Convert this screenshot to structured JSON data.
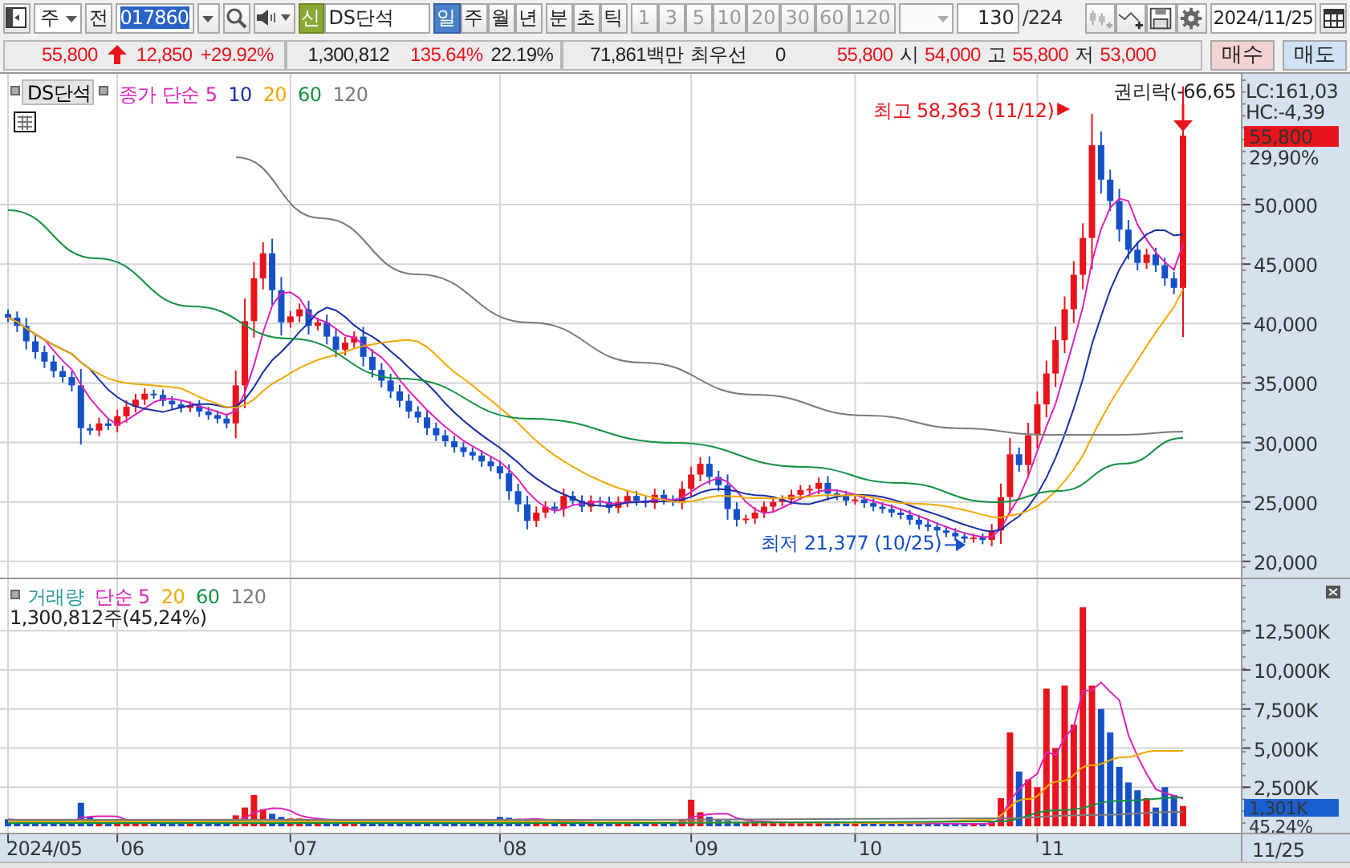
{
  "toolbar": {
    "market_select": {
      "value": "주"
    },
    "prev_button": "전",
    "code_field": {
      "value": "017860"
    },
    "name_badge": "신",
    "name_field": {
      "value": "DS단석"
    },
    "periods": [
      {
        "label": "일",
        "selected": true
      },
      {
        "label": "주",
        "selected": false
      },
      {
        "label": "월",
        "selected": false
      },
      {
        "label": "년",
        "selected": false
      },
      {
        "label": "분",
        "selected": false
      },
      {
        "label": "초",
        "selected": false
      },
      {
        "label": "틱",
        "selected": false
      }
    ],
    "intervals": [
      {
        "label": "1",
        "disabled": true
      },
      {
        "label": "3",
        "disabled": true
      },
      {
        "label": "5",
        "disabled": true
      },
      {
        "label": "10",
        "disabled": true
      },
      {
        "label": "20",
        "disabled": true
      },
      {
        "label": "30",
        "disabled": true
      },
      {
        "label": "60",
        "disabled": true
      },
      {
        "label": "120",
        "disabled": true
      }
    ],
    "count_field": {
      "value": "130"
    },
    "count_total": "/224",
    "date_field": {
      "value": "2024/11/25"
    }
  },
  "quote": {
    "price": "55,800",
    "change": "12,850",
    "change_rate": "+29.92%",
    "volume": "1,300,812",
    "volume_ratio": "135.64%",
    "turnover": "22.19%",
    "amount": "71,861백만",
    "best_label": "최우선",
    "best_qty": "0",
    "best_price": "55,800",
    "fields": [
      {
        "label": "시",
        "value": "54,000"
      },
      {
        "label": "고",
        "value": "55,800"
      },
      {
        "label": "저",
        "value": "53,000"
      }
    ],
    "buttons": [
      {
        "label": "매수",
        "kind": "buy"
      },
      {
        "label": "매도",
        "kind": "sell"
      }
    ]
  },
  "price_pane": {
    "name_tag": "DS단석",
    "legend": [
      {
        "label": "종가 단순 5",
        "color": "#dd22bb"
      },
      {
        "label": "10",
        "color": "#1a2fa8"
      },
      {
        "label": "20",
        "color": "#f0a800"
      },
      {
        "label": "60",
        "color": "#129140"
      },
      {
        "label": "120",
        "color": "#7a7a7a"
      }
    ],
    "high_note": "최고 58,363 (11/12)",
    "low_note": "최저 21,377 (10/25)",
    "rights_note": "권리락(-66,65",
    "lc": "LC:161,03",
    "hc": "HC:-4,39",
    "last_price": "55,800",
    "last_rate": "29,90%",
    "axis_labels": [
      "50,000",
      "45,000",
      "40,000",
      "35,000",
      "30,000",
      "25,000",
      "20,000"
    ]
  },
  "volume_pane": {
    "legend": [
      {
        "label": "거래량",
        "color": "#2a9a9a"
      },
      {
        "label": "단순 5",
        "color": "#dd22bb"
      },
      {
        "label": "20",
        "color": "#f0a800"
      },
      {
        "label": "60",
        "color": "#129140"
      },
      {
        "label": "120",
        "color": "#7a7a7a"
      }
    ],
    "summary": "1,300,812주(45,24%)",
    "last_volume": "1,301K",
    "last_rate": "45,24%",
    "axis_labels": [
      "12,500K",
      "10,000K",
      "7,500K",
      "5,000K",
      "2,500K"
    ]
  },
  "date_axis": {
    "labels": [
      "2024/05",
      "06",
      "07",
      "08",
      "09",
      "10",
      "11"
    ],
    "current": "11/25"
  }
}
